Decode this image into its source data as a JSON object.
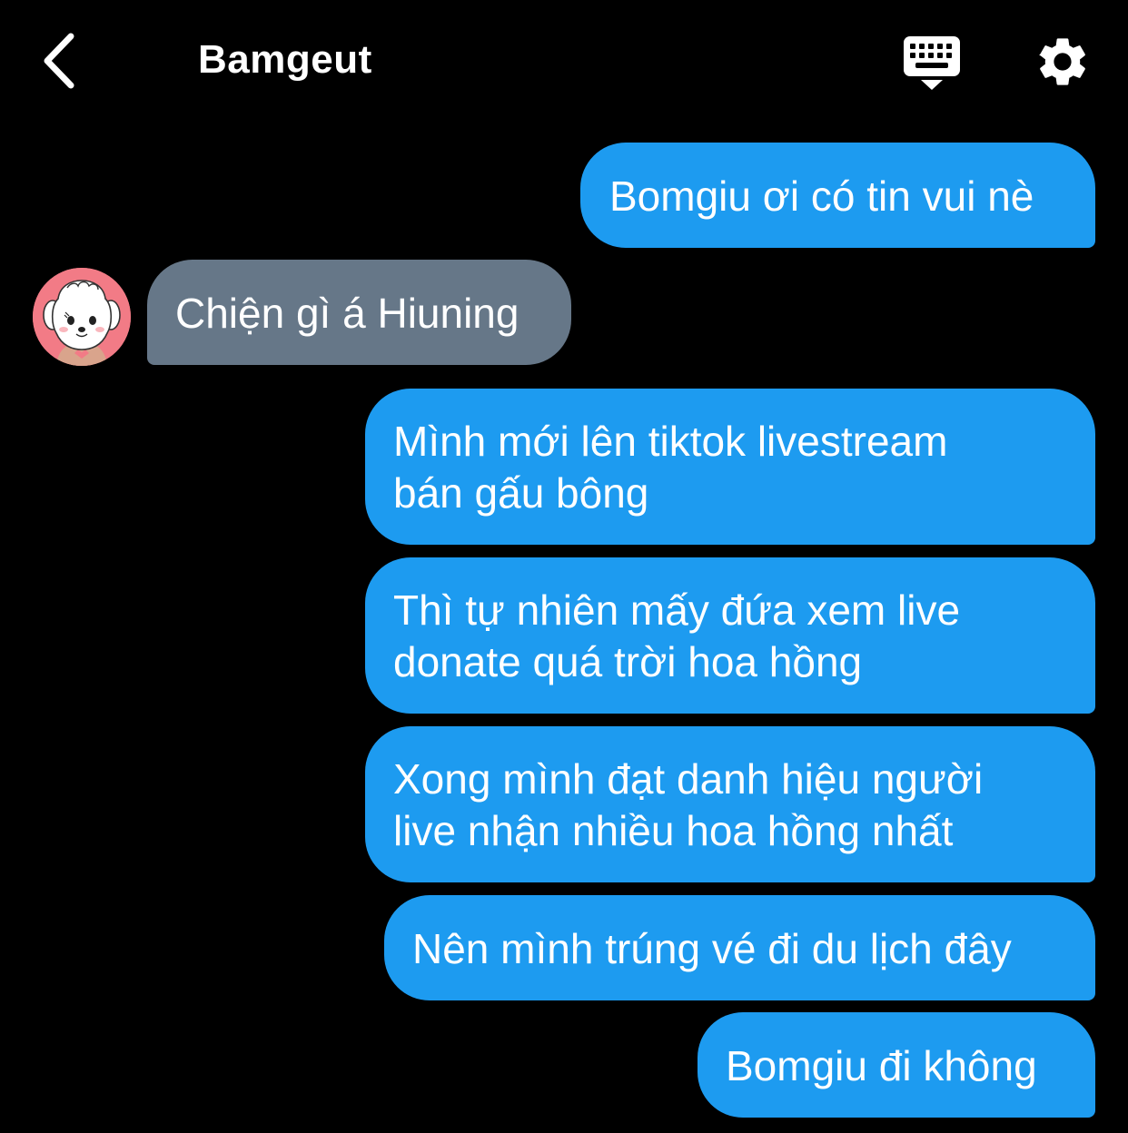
{
  "header": {
    "title": "Bamgeut",
    "back_icon": "chevron-left-icon",
    "keyboard_icon": "keyboard-icon",
    "settings_icon": "gear-icon"
  },
  "colors": {
    "background": "#000000",
    "outgoing_bubble": "#1d9bf0",
    "incoming_bubble": "#667788",
    "text": "#ffffff",
    "avatar_bg": "#f27b86"
  },
  "messages": [
    {
      "direction": "out",
      "lines": [
        "Bomgiu ơi có tin vui nè"
      ]
    },
    {
      "direction": "in",
      "lines": [
        "Chiện gì á Hiuning"
      ]
    },
    {
      "direction": "out",
      "lines": [
        "Mình mới lên tiktok livestream",
        "bán gấu bông"
      ]
    },
    {
      "direction": "out",
      "lines": [
        "Thì tự nhiên mấy đứa xem live",
        "donate quá trời hoa hồng"
      ]
    },
    {
      "direction": "out",
      "lines": [
        "Xong mình đạt danh hiệu người",
        "live nhận nhiều hoa hồng nhất"
      ]
    },
    {
      "direction": "out",
      "lines": [
        "Nên mình trúng vé đi du lịch đây"
      ]
    },
    {
      "direction": "out",
      "lines": [
        "Bomgiu đi không"
      ]
    }
  ]
}
